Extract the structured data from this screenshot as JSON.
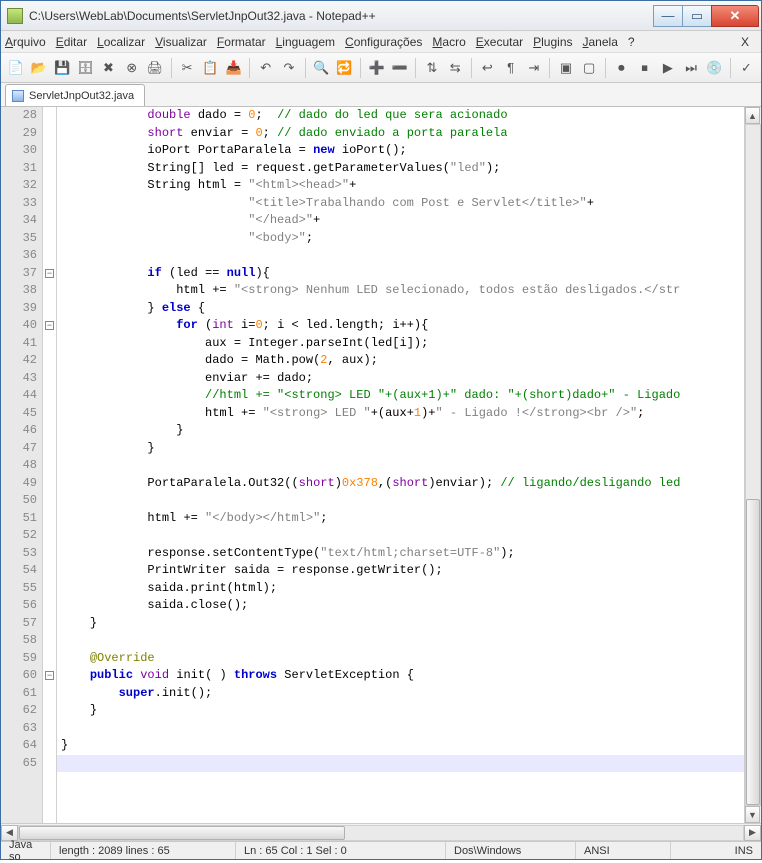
{
  "window": {
    "title": "C:\\Users\\WebLab\\Documents\\ServletJnpOut32.java - Notepad++"
  },
  "menu": {
    "items": [
      {
        "label": "Arquivo",
        "ul": 0
      },
      {
        "label": "Editar",
        "ul": 0
      },
      {
        "label": "Localizar",
        "ul": 0
      },
      {
        "label": "Visualizar",
        "ul": 0
      },
      {
        "label": "Formatar",
        "ul": 0
      },
      {
        "label": "Linguagem",
        "ul": 0
      },
      {
        "label": "Configurações",
        "ul": 0
      },
      {
        "label": "Macro",
        "ul": 0
      },
      {
        "label": "Executar",
        "ul": 0
      },
      {
        "label": "Plugins",
        "ul": 0
      },
      {
        "label": "Janela",
        "ul": 0
      },
      {
        "label": "?",
        "ul": -1
      }
    ],
    "closeX": "X"
  },
  "toolbar_icons": [
    "new-icon",
    "open-icon",
    "save-icon",
    "save-all-icon",
    "close-icon",
    "close-all-icon",
    "print-icon",
    "sep",
    "cut-icon",
    "copy-icon",
    "paste-icon",
    "sep",
    "undo-icon",
    "redo-icon",
    "sep",
    "find-icon",
    "replace-icon",
    "sep",
    "zoom-in-icon",
    "zoom-out-icon",
    "sep",
    "sync-v-icon",
    "sync-h-icon",
    "sep",
    "wrap-icon",
    "all-chars-icon",
    "indent-icon",
    "sep",
    "fold-icon",
    "unfold-icon",
    "sep",
    "record-icon",
    "stop-icon",
    "play-icon",
    "play-multi-icon",
    "save-macro-icon",
    "sep",
    "spell-icon"
  ],
  "tab": {
    "name": "ServletJnpOut32.java"
  },
  "code": {
    "startLine": 28,
    "folds": [
      {
        "line": 37,
        "sym": "−"
      },
      {
        "line": 40,
        "sym": "−"
      },
      {
        "line": 60,
        "sym": "−"
      }
    ],
    "lines": [
      [
        [
          "sp",
          "            "
        ],
        [
          "ty",
          "double"
        ],
        [
          "sp",
          " "
        ],
        [
          "id",
          "dado"
        ],
        [
          "sp",
          " "
        ],
        [
          "op",
          "="
        ],
        [
          "sp",
          " "
        ],
        [
          "num",
          "0"
        ],
        [
          "op",
          ";"
        ],
        [
          "sp",
          "  "
        ],
        [
          "cm",
          "// dado do led que sera acionado"
        ]
      ],
      [
        [
          "sp",
          "            "
        ],
        [
          "ty",
          "short"
        ],
        [
          "sp",
          " "
        ],
        [
          "id",
          "enviar"
        ],
        [
          "sp",
          " "
        ],
        [
          "op",
          "="
        ],
        [
          "sp",
          " "
        ],
        [
          "num",
          "0"
        ],
        [
          "op",
          ";"
        ],
        [
          "sp",
          " "
        ],
        [
          "cm",
          "// dado enviado a porta paralela"
        ]
      ],
      [
        [
          "sp",
          "            "
        ],
        [
          "id",
          "ioPort PortaParalela "
        ],
        [
          "op",
          "="
        ],
        [
          "sp",
          " "
        ],
        [
          "kw",
          "new"
        ],
        [
          "sp",
          " "
        ],
        [
          "id",
          "ioPort"
        ],
        [
          "op",
          "();"
        ]
      ],
      [
        [
          "sp",
          "            "
        ],
        [
          "id",
          "String"
        ],
        [
          "op",
          "[]"
        ],
        [
          "sp",
          " "
        ],
        [
          "id",
          "led"
        ],
        [
          "sp",
          " "
        ],
        [
          "op",
          "="
        ],
        [
          "sp",
          " "
        ],
        [
          "id",
          "request"
        ],
        [
          "op",
          "."
        ],
        [
          "id",
          "getParameterValues"
        ],
        [
          "op",
          "("
        ],
        [
          "str",
          "\"led\""
        ],
        [
          "op",
          ");"
        ]
      ],
      [
        [
          "sp",
          "            "
        ],
        [
          "id",
          "String html "
        ],
        [
          "op",
          "="
        ],
        [
          "sp",
          " "
        ],
        [
          "str",
          "\"<html><head>\""
        ],
        [
          "op",
          "+"
        ]
      ],
      [
        [
          "sp",
          "                          "
        ],
        [
          "str",
          "\"<title>Trabalhando com Post e Servlet</title>\""
        ],
        [
          "op",
          "+"
        ]
      ],
      [
        [
          "sp",
          "                          "
        ],
        [
          "str",
          "\"</head>\""
        ],
        [
          "op",
          "+"
        ]
      ],
      [
        [
          "sp",
          "                          "
        ],
        [
          "str",
          "\"<body>\""
        ],
        [
          "op",
          ";"
        ]
      ],
      [
        [
          "sp",
          ""
        ]
      ],
      [
        [
          "sp",
          "            "
        ],
        [
          "kw",
          "if"
        ],
        [
          "sp",
          " "
        ],
        [
          "op",
          "("
        ],
        [
          "id",
          "led"
        ],
        [
          "sp",
          " "
        ],
        [
          "op",
          "=="
        ],
        [
          "sp",
          " "
        ],
        [
          "kw",
          "null"
        ],
        [
          "op",
          ")"
        ],
        [
          "op",
          "{"
        ]
      ],
      [
        [
          "sp",
          "                "
        ],
        [
          "id",
          "html"
        ],
        [
          "sp",
          " "
        ],
        [
          "op",
          "+="
        ],
        [
          "sp",
          " "
        ],
        [
          "str",
          "\"<strong> Nenhum LED selecionado, todos estão desligados.</str"
        ]
      ],
      [
        [
          "sp",
          "            "
        ],
        [
          "op",
          "}"
        ],
        [
          "sp",
          " "
        ],
        [
          "kw",
          "else"
        ],
        [
          "sp",
          " "
        ],
        [
          "op",
          "{"
        ]
      ],
      [
        [
          "sp",
          "                "
        ],
        [
          "kw",
          "for"
        ],
        [
          "sp",
          " "
        ],
        [
          "op",
          "("
        ],
        [
          "ty",
          "int"
        ],
        [
          "sp",
          " "
        ],
        [
          "id",
          "i"
        ],
        [
          "op",
          "="
        ],
        [
          "num",
          "0"
        ],
        [
          "op",
          ";"
        ],
        [
          "sp",
          " "
        ],
        [
          "id",
          "i"
        ],
        [
          "sp",
          " "
        ],
        [
          "op",
          "<"
        ],
        [
          "sp",
          " "
        ],
        [
          "id",
          "led"
        ],
        [
          "op",
          "."
        ],
        [
          "id",
          "length"
        ],
        [
          "op",
          ";"
        ],
        [
          "sp",
          " "
        ],
        [
          "id",
          "i"
        ],
        [
          "op",
          "++)"
        ],
        [
          "op",
          "{"
        ]
      ],
      [
        [
          "sp",
          "                    "
        ],
        [
          "id",
          "aux"
        ],
        [
          "sp",
          " "
        ],
        [
          "op",
          "="
        ],
        [
          "sp",
          " "
        ],
        [
          "id",
          "Integer"
        ],
        [
          "op",
          "."
        ],
        [
          "id",
          "parseInt"
        ],
        [
          "op",
          "("
        ],
        [
          "id",
          "led"
        ],
        [
          "op",
          "["
        ],
        [
          "id",
          "i"
        ],
        [
          "op",
          "]);"
        ]
      ],
      [
        [
          "sp",
          "                    "
        ],
        [
          "id",
          "dado"
        ],
        [
          "sp",
          " "
        ],
        [
          "op",
          "="
        ],
        [
          "sp",
          " "
        ],
        [
          "id",
          "Math"
        ],
        [
          "op",
          "."
        ],
        [
          "id",
          "pow"
        ],
        [
          "op",
          "("
        ],
        [
          "num",
          "2"
        ],
        [
          "op",
          ","
        ],
        [
          "sp",
          " "
        ],
        [
          "id",
          "aux"
        ],
        [
          "op",
          ");"
        ]
      ],
      [
        [
          "sp",
          "                    "
        ],
        [
          "id",
          "enviar"
        ],
        [
          "sp",
          " "
        ],
        [
          "op",
          "+="
        ],
        [
          "sp",
          " "
        ],
        [
          "id",
          "dado"
        ],
        [
          "op",
          ";"
        ]
      ],
      [
        [
          "sp",
          "                    "
        ],
        [
          "cm",
          "//html += \"<strong> LED \"+(aux+1)+\" dado: \"+(short)dado+\" - Ligado"
        ]
      ],
      [
        [
          "sp",
          "                    "
        ],
        [
          "id",
          "html"
        ],
        [
          "sp",
          " "
        ],
        [
          "op",
          "+="
        ],
        [
          "sp",
          " "
        ],
        [
          "str",
          "\"<strong> LED \""
        ],
        [
          "op",
          "+("
        ],
        [
          "id",
          "aux"
        ],
        [
          "op",
          "+"
        ],
        [
          "num",
          "1"
        ],
        [
          "op",
          ")+"
        ],
        [
          "str",
          "\" - Ligado !</strong><br />\""
        ],
        [
          "op",
          ";"
        ]
      ],
      [
        [
          "sp",
          "                "
        ],
        [
          "op",
          "}"
        ]
      ],
      [
        [
          "sp",
          "            "
        ],
        [
          "op",
          "}"
        ]
      ],
      [
        [
          "sp",
          ""
        ]
      ],
      [
        [
          "sp",
          "            "
        ],
        [
          "id",
          "PortaParalela"
        ],
        [
          "op",
          "."
        ],
        [
          "id",
          "Out32"
        ],
        [
          "op",
          "(("
        ],
        [
          "ty",
          "short"
        ],
        [
          "op",
          ")"
        ],
        [
          "num",
          "0x378"
        ],
        [
          "op",
          ",("
        ],
        [
          "ty",
          "short"
        ],
        [
          "op",
          ")"
        ],
        [
          "id",
          "enviar"
        ],
        [
          "op",
          ");"
        ],
        [
          "sp",
          " "
        ],
        [
          "cm",
          "// ligando/desligando led"
        ]
      ],
      [
        [
          "sp",
          ""
        ]
      ],
      [
        [
          "sp",
          "            "
        ],
        [
          "id",
          "html"
        ],
        [
          "sp",
          " "
        ],
        [
          "op",
          "+="
        ],
        [
          "sp",
          " "
        ],
        [
          "str",
          "\"</body></html>\""
        ],
        [
          "op",
          ";"
        ]
      ],
      [
        [
          "sp",
          ""
        ]
      ],
      [
        [
          "sp",
          "            "
        ],
        [
          "id",
          "response"
        ],
        [
          "op",
          "."
        ],
        [
          "id",
          "setContentType"
        ],
        [
          "op",
          "("
        ],
        [
          "str",
          "\"text/html;charset=UTF-8\""
        ],
        [
          "op",
          ");"
        ]
      ],
      [
        [
          "sp",
          "            "
        ],
        [
          "id",
          "PrintWriter saida "
        ],
        [
          "op",
          "="
        ],
        [
          "sp",
          " "
        ],
        [
          "id",
          "response"
        ],
        [
          "op",
          "."
        ],
        [
          "id",
          "getWriter"
        ],
        [
          "op",
          "();"
        ]
      ],
      [
        [
          "sp",
          "            "
        ],
        [
          "id",
          "saida"
        ],
        [
          "op",
          "."
        ],
        [
          "id",
          "print"
        ],
        [
          "op",
          "("
        ],
        [
          "id",
          "html"
        ],
        [
          "op",
          ");"
        ]
      ],
      [
        [
          "sp",
          "            "
        ],
        [
          "id",
          "saida"
        ],
        [
          "op",
          "."
        ],
        [
          "id",
          "close"
        ],
        [
          "op",
          "();"
        ]
      ],
      [
        [
          "sp",
          "    "
        ],
        [
          "op",
          "}"
        ]
      ],
      [
        [
          "sp",
          ""
        ]
      ],
      [
        [
          "sp",
          "    "
        ],
        [
          "ann",
          "@Override"
        ]
      ],
      [
        [
          "sp",
          "    "
        ],
        [
          "kw",
          "public"
        ],
        [
          "sp",
          " "
        ],
        [
          "ty",
          "void"
        ],
        [
          "sp",
          " "
        ],
        [
          "id",
          "init"
        ],
        [
          "op",
          "( )"
        ],
        [
          "sp",
          " "
        ],
        [
          "kw",
          "throws"
        ],
        [
          "sp",
          " "
        ],
        [
          "id",
          "ServletException"
        ],
        [
          "sp",
          " "
        ],
        [
          "op",
          "{"
        ]
      ],
      [
        [
          "sp",
          "        "
        ],
        [
          "kw",
          "super"
        ],
        [
          "op",
          "."
        ],
        [
          "id",
          "init"
        ],
        [
          "op",
          "();"
        ]
      ],
      [
        [
          "sp",
          "    "
        ],
        [
          "op",
          "}"
        ]
      ],
      [
        [
          "sp",
          ""
        ]
      ],
      [
        [
          "op",
          "}"
        ]
      ],
      [
        [
          "sp",
          ""
        ]
      ]
    ]
  },
  "status": {
    "lang": "Java so",
    "length": "length : 2089    lines : 65",
    "pos": "Ln : 65    Col : 1    Sel : 0",
    "eol": "Dos\\Windows",
    "enc": "ANSI",
    "mode": "INS"
  }
}
